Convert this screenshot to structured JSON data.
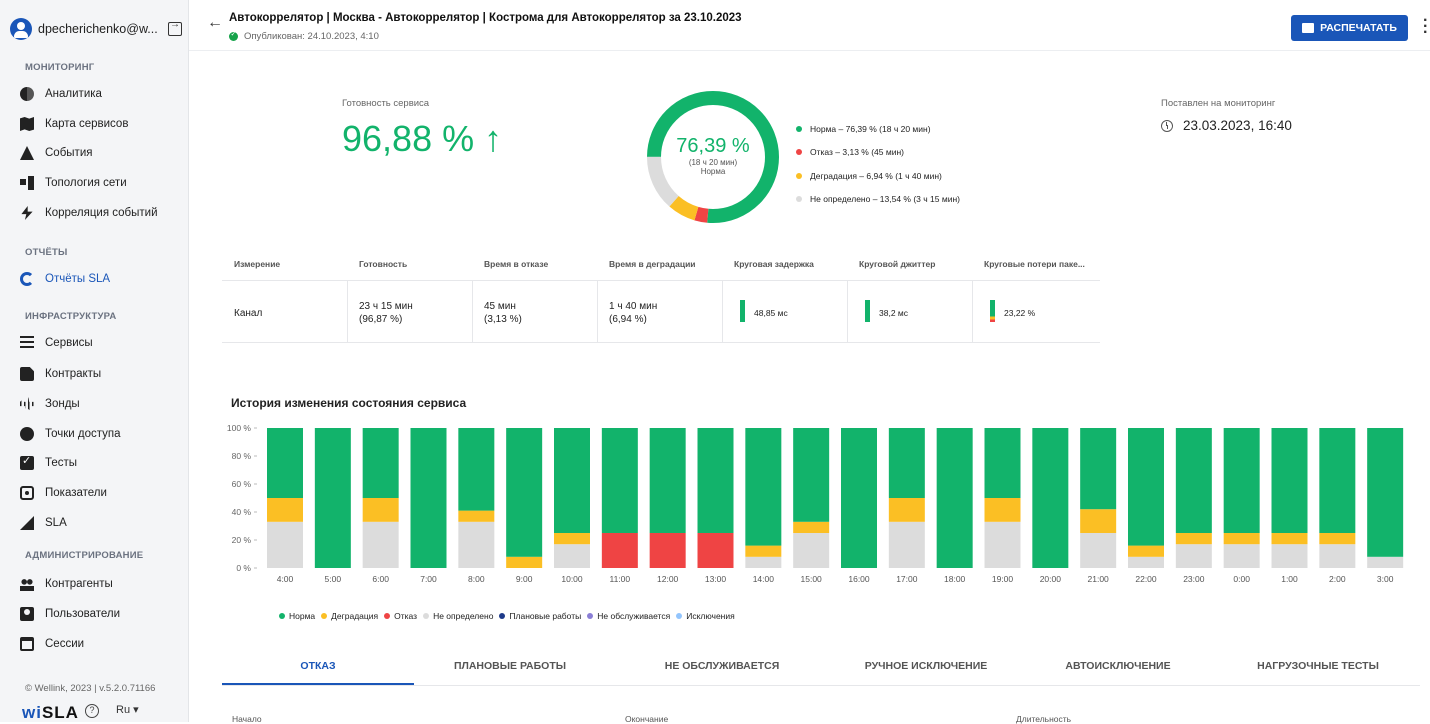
{
  "user": {
    "name": "dpecherichenko@w..."
  },
  "sidebar": {
    "sections": {
      "monitoring": "МОНИТОРИНГ",
      "reports": "ОТЧЁТЫ",
      "infra": "ИНФРАСТРУКТУРА",
      "admin": "АДМИНИСТРИРОВАНИЕ"
    },
    "items": [
      {
        "label": "Аналитика",
        "icon": "analytics-icon"
      },
      {
        "label": "Карта сервисов",
        "icon": "map-icon"
      },
      {
        "label": "События",
        "icon": "warning-icon"
      },
      {
        "label": "Топология сети",
        "icon": "topology-icon"
      },
      {
        "label": "Корреляция событий",
        "icon": "bolt-icon"
      },
      {
        "label": "Отчёты SLA",
        "icon": "sla-report-icon"
      },
      {
        "label": "Сервисы",
        "icon": "list-icon"
      },
      {
        "label": "Контракты",
        "icon": "document-icon"
      },
      {
        "label": "Зонды",
        "icon": "probe-icon"
      },
      {
        "label": "Точки доступа",
        "icon": "access-point-icon"
      },
      {
        "label": "Тесты",
        "icon": "checkbox-icon"
      },
      {
        "label": "Показатели",
        "icon": "metrics-icon"
      },
      {
        "label": "SLA",
        "icon": "sla-icon"
      },
      {
        "label": "Контрагенты",
        "icon": "people-icon"
      },
      {
        "label": "Пользователи",
        "icon": "user-icon"
      },
      {
        "label": "Сессии",
        "icon": "window-icon"
      }
    ],
    "version": "© Wellink, 2023 | v.5.2.0.71166",
    "brand_a": "wi",
    "brand_b": "SLA",
    "lang": "Ru ▾"
  },
  "header": {
    "title": "Автокоррелятор | Москва - Автокоррелятор | Кострома для Автокоррелятор за 23.10.2023",
    "published": "Опубликован: 24.10.2023, 4:10",
    "print_label": "РАСПЕЧАТАТЬ"
  },
  "summary": {
    "availability_label": "Готовность сервиса",
    "availability_value": "96,88 % ↑",
    "donut_pct": "76,39 %",
    "donut_sub": "(18 ч 20 мин)",
    "donut_state": "Норма",
    "legend": [
      {
        "label": "Норма – 76,39 % (18 ч 20 мин)",
        "color": "#12b36b",
        "share": 76.39
      },
      {
        "label": "Отказ – 3,13 % (45 мин)",
        "color": "#ef4444",
        "share": 3.13
      },
      {
        "label": "Деградация – 6,94 % (1 ч 40 мин)",
        "color": "#fbbf24",
        "share": 6.94
      },
      {
        "label": "Не определено – 13,54 % (3 ч 15 мин)",
        "color": "#dcdcdc",
        "share": 13.54
      }
    ],
    "monitor_label": "Поставлен на мониторинг",
    "monitor_value": "23.03.2023, 16:40"
  },
  "table": {
    "headers": [
      "Измерение",
      "Готовность",
      "Время в отказе",
      "Время в деградации",
      "Круговая задержка",
      "Круговой джиттер",
      "Круговые потери паке..."
    ],
    "row": {
      "dim": "Канал",
      "ready_a": "23 ч 15 мин",
      "ready_b": "(96,87 %)",
      "fail_a": "45 мин",
      "fail_b": "(3,13 %)",
      "degr_a": "1 ч 40 мин",
      "degr_b": "(6,94 %)",
      "delay": "48,85 мс",
      "jitter": "38,2 мс",
      "loss": "23,22 %"
    }
  },
  "history": {
    "title": "История изменения состояния сервиса"
  },
  "chart_data": {
    "type": "bar",
    "stacked": true,
    "categories": [
      "4:00",
      "5:00",
      "6:00",
      "7:00",
      "8:00",
      "9:00",
      "10:00",
      "11:00",
      "12:00",
      "13:00",
      "14:00",
      "15:00",
      "16:00",
      "17:00",
      "18:00",
      "19:00",
      "20:00",
      "21:00",
      "22:00",
      "23:00",
      "0:00",
      "1:00",
      "2:00",
      "3:00"
    ],
    "ylim": [
      0,
      100
    ],
    "yticks": [
      "0 %",
      "20 %",
      "40 %",
      "60 %",
      "80 %",
      "100 %"
    ],
    "series": [
      {
        "name": "Не определено",
        "color": "#dcdcdc",
        "values": [
          33,
          0,
          33,
          0,
          33,
          0,
          17,
          0,
          0,
          0,
          8,
          25,
          0,
          33,
          0,
          33,
          0,
          25,
          8,
          17,
          17,
          17,
          17,
          8
        ]
      },
      {
        "name": "Отказ",
        "color": "#ef4444",
        "values": [
          0,
          0,
          0,
          0,
          0,
          0,
          0,
          25,
          25,
          25,
          0,
          0,
          0,
          0,
          0,
          0,
          0,
          0,
          0,
          0,
          0,
          0,
          0,
          0
        ]
      },
      {
        "name": "Деградация",
        "color": "#fbbf24",
        "values": [
          17,
          0,
          17,
          0,
          8,
          8,
          8,
          0,
          0,
          0,
          8,
          8,
          0,
          17,
          0,
          17,
          0,
          17,
          8,
          8,
          8,
          8,
          8,
          0
        ]
      },
      {
        "name": "Норма",
        "color": "#12b36b",
        "values": [
          50,
          100,
          50,
          100,
          59,
          92,
          75,
          75,
          75,
          75,
          84,
          67,
          100,
          50,
          100,
          50,
          100,
          58,
          84,
          75,
          75,
          75,
          75,
          92
        ]
      }
    ],
    "legend": [
      {
        "name": "Норма",
        "color": "#12b36b"
      },
      {
        "name": "Деградация",
        "color": "#fbbf24"
      },
      {
        "name": "Отказ",
        "color": "#ef4444"
      },
      {
        "name": "Не определено",
        "color": "#dcdcdc"
      },
      {
        "name": "Плановые работы",
        "color": "#1e3a8a"
      },
      {
        "name": "Не обслуживается",
        "color": "#8b7fd6"
      },
      {
        "name": "Исключения",
        "color": "#93c5fd"
      }
    ]
  },
  "tabs": [
    "ОТКАЗ",
    "ПЛАНОВЫЕ РАБОТЫ",
    "НЕ ОБСЛУЖИВАЕТСЯ",
    "РУЧНОЕ ИСКЛЮЧЕНИЕ",
    "АВТОИСКЛЮЧЕНИЕ",
    "НАГРУЗОЧНЫЕ ТЕСТЫ"
  ],
  "bottom_cols": [
    "Начало",
    "Окончание",
    "Длительность"
  ]
}
